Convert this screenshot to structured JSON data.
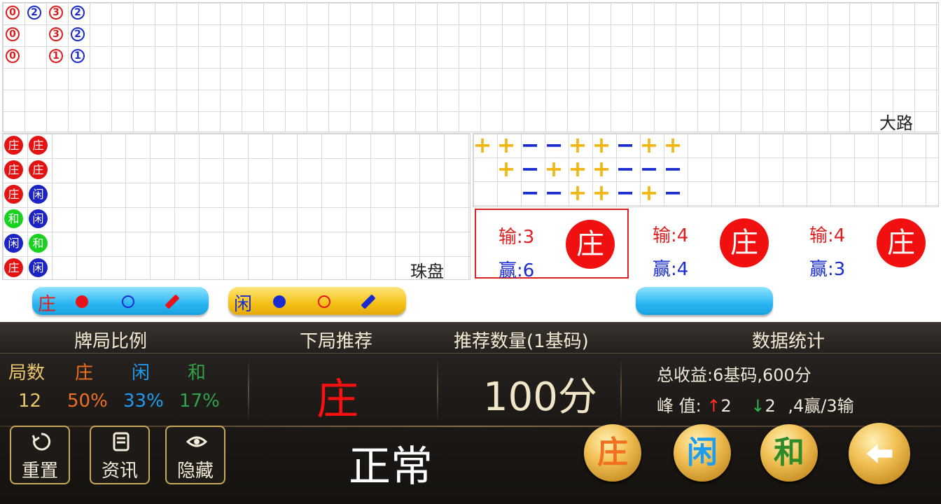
{
  "bigroad": {
    "label": "大路",
    "cells": [
      {
        "col": 0,
        "row": 0,
        "text": "0",
        "color": "red"
      },
      {
        "col": 1,
        "row": 0,
        "text": "2",
        "color": "blue"
      },
      {
        "col": 2,
        "row": 0,
        "text": "3",
        "color": "red"
      },
      {
        "col": 3,
        "row": 0,
        "text": "2",
        "color": "blue"
      },
      {
        "col": 0,
        "row": 1,
        "text": "0",
        "color": "red"
      },
      {
        "col": 2,
        "row": 1,
        "text": "3",
        "color": "red"
      },
      {
        "col": 3,
        "row": 1,
        "text": "2",
        "color": "blue"
      },
      {
        "col": 0,
        "row": 2,
        "text": "0",
        "color": "red"
      },
      {
        "col": 2,
        "row": 2,
        "text": "1",
        "color": "red"
      },
      {
        "col": 3,
        "row": 2,
        "text": "1",
        "color": "blue"
      }
    ]
  },
  "beadplate": {
    "label": "珠盘",
    "beads": [
      {
        "col": 0,
        "row": 0,
        "text": "庄",
        "color": "red"
      },
      {
        "col": 1,
        "row": 0,
        "text": "庄",
        "color": "red"
      },
      {
        "col": 0,
        "row": 1,
        "text": "庄",
        "color": "red"
      },
      {
        "col": 1,
        "row": 1,
        "text": "庄",
        "color": "red"
      },
      {
        "col": 0,
        "row": 2,
        "text": "庄",
        "color": "red"
      },
      {
        "col": 1,
        "row": 2,
        "text": "闲",
        "color": "blue"
      },
      {
        "col": 0,
        "row": 3,
        "text": "和",
        "color": "green"
      },
      {
        "col": 1,
        "row": 3,
        "text": "闲",
        "color": "blue"
      },
      {
        "col": 0,
        "row": 4,
        "text": "闲",
        "color": "blue"
      },
      {
        "col": 1,
        "row": 4,
        "text": "和",
        "color": "green"
      },
      {
        "col": 0,
        "row": 5,
        "text": "庄",
        "color": "red"
      },
      {
        "col": 1,
        "row": 5,
        "text": "闲",
        "color": "blue"
      }
    ]
  },
  "derived_road": {
    "rows": [
      "++--++-++",
      " +-+++---",
      "  --++-+-"
    ]
  },
  "cards": [
    {
      "lose": "输:3",
      "win": "赢:6",
      "pick": "庄",
      "selected": true
    },
    {
      "lose": "输:4",
      "win": "赢:4",
      "pick": "庄",
      "selected": false
    },
    {
      "lose": "输:4",
      "win": "赢:3",
      "pick": "庄",
      "selected": false
    }
  ],
  "predict_buttons": {
    "banker_label": "庄",
    "player_label": "闲"
  },
  "panel": {
    "headers": {
      "ratio": "牌局比例",
      "next": "下局推荐",
      "amount": "推荐数量(1基码)",
      "stats": "数据统计"
    },
    "ratio": {
      "count_label": "局数",
      "banker_label": "庄",
      "player_label": "闲",
      "tie_label": "和",
      "count": "12",
      "banker": "50%",
      "player": "33%",
      "tie": "17%"
    },
    "next_pick": "庄",
    "amount": "100分",
    "stats": {
      "total": "总收益:6基码,600分",
      "peak_label": "峰 值:",
      "peak_up": "2",
      "peak_down": "2",
      "peak_tail": ",4赢/3输"
    },
    "mode": "正常",
    "tools": {
      "reset": "重置",
      "news": "资讯",
      "hide": "隐藏"
    },
    "bet": {
      "banker": "庄",
      "player": "闲",
      "tie": "和"
    },
    "colors": {
      "banker": "#f07020",
      "player": "#1e9cf0",
      "tie": "#2fa24a"
    }
  }
}
